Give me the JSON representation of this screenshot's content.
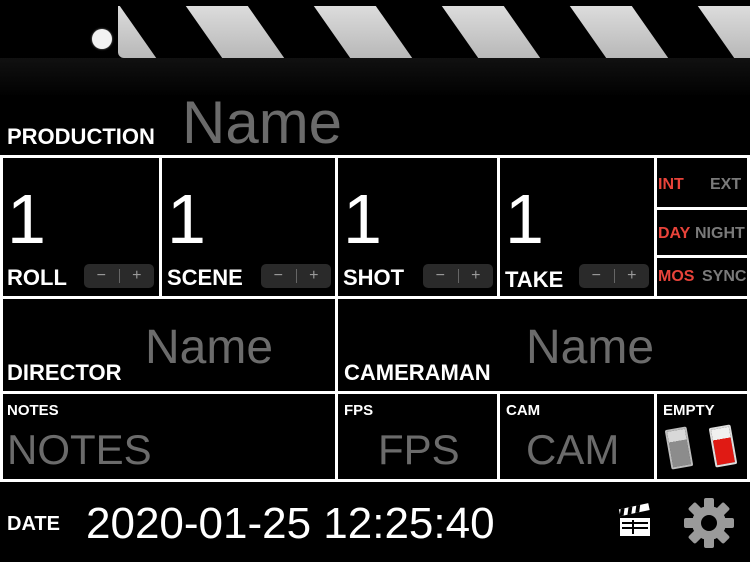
{
  "production": {
    "label": "PRODUCTION",
    "placeholder": "Name"
  },
  "counters": [
    {
      "label": "ROLL",
      "value": "1",
      "minus": "−",
      "plus": "+"
    },
    {
      "label": "SCENE",
      "value": "1",
      "minus": "−",
      "plus": "+"
    },
    {
      "label": "SHOT",
      "value": "1",
      "minus": "−",
      "plus": "+"
    },
    {
      "label": "TAKE",
      "value": "1",
      "minus": "−",
      "plus": "+"
    }
  ],
  "toggles": [
    {
      "on": "INT",
      "off": "EXT"
    },
    {
      "on": "DAY",
      "off": "NIGHT"
    },
    {
      "on": "MOS",
      "off": "SYNC"
    }
  ],
  "director": {
    "label": "DIRECTOR",
    "placeholder": "Name"
  },
  "cameraman": {
    "label": "CAMERAMAN",
    "placeholder": "Name"
  },
  "notes": {
    "label": "NOTES",
    "placeholder": "NOTES"
  },
  "fps": {
    "label": "FPS",
    "placeholder": "FPS"
  },
  "cam": {
    "label": "CAM",
    "placeholder": "CAM"
  },
  "empty": {
    "label": "EMPTY"
  },
  "date": {
    "label": "DATE",
    "value": "2020-01-25 12:25:40"
  },
  "colors": {
    "accent": "#e8433a",
    "ghost": "#6b6b6b",
    "muted": "#7a7a7a"
  },
  "icons": {
    "clapper": "clapperboard-icon",
    "settings": "gear-icon"
  }
}
